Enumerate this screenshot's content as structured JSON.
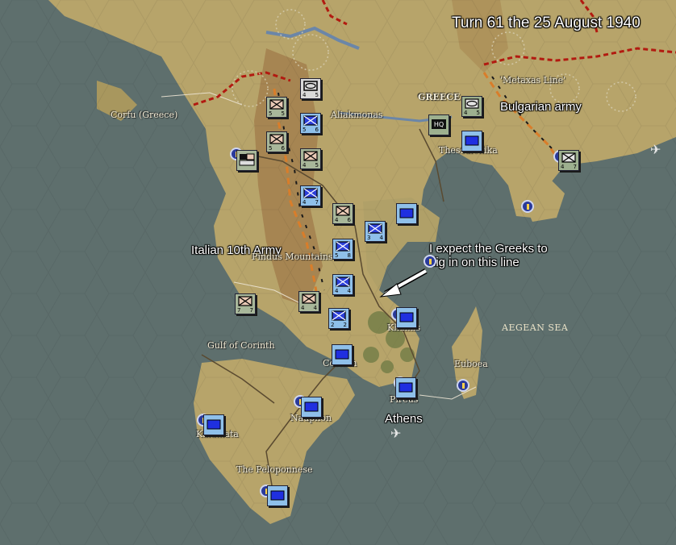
{
  "title": "Turn 61 the 25 August 1940",
  "annotations": {
    "bulgarian_army": "Bulgarian army",
    "italian_army": "Italian 10th Army",
    "expect": "I expect the Greeks to\ndig in on this line",
    "athens": "Athens"
  },
  "places": {
    "corfu": "Corfu (Greece)",
    "aliakmonas": "Aliakmonas",
    "greece": "GREECE",
    "thessaloniki": "Thessalonika",
    "metaxas": "'Metaxas Line'",
    "pindus": "Pindus Mountains",
    "gulf_corinth": "Gulf of Corinth",
    "corinth": "Corinth",
    "khalkis": "Khalkis",
    "aegean": "AEGEAN SEA",
    "euboea": "Euboea",
    "peloponnese": "The Peloponnese",
    "nauplion": "Nauplion",
    "kalamata": "Kalamata",
    "pireus": "Pireus"
  },
  "units": [
    {
      "id": "u1",
      "type": "axis-armor",
      "strength": "4",
      "moves": "5"
    },
    {
      "id": "u2",
      "type": "axis-infantry",
      "strength": "5",
      "moves": "5"
    },
    {
      "id": "u3",
      "type": "greek-infantry",
      "strength": "5",
      "moves": "6"
    },
    {
      "id": "u4",
      "type": "axis-infantry",
      "strength": "5",
      "moves": "6"
    },
    {
      "id": "u5",
      "type": "axis-mixed",
      "strength": "",
      "moves": ""
    },
    {
      "id": "u6",
      "type": "axis-infantry",
      "strength": "4",
      "moves": "5"
    },
    {
      "id": "u7",
      "type": "greek-infantry",
      "strength": "4",
      "moves": "7"
    },
    {
      "id": "u8",
      "type": "axis-infantry",
      "strength": "4",
      "moves": "6"
    },
    {
      "id": "u9",
      "type": "greek-infantry",
      "strength": "3",
      "moves": "4"
    },
    {
      "id": "u10",
      "type": "greek-infantry",
      "strength": "5",
      "moves": "8"
    },
    {
      "id": "u11",
      "type": "greek-infantry",
      "strength": "4",
      "moves": "4"
    },
    {
      "id": "u12",
      "type": "axis-infantry",
      "strength": "4",
      "moves": "4"
    },
    {
      "id": "u13",
      "type": "greek-infantry",
      "strength": "2",
      "moves": "2"
    },
    {
      "id": "u14",
      "type": "axis-infantry",
      "strength": "7",
      "moves": "7"
    },
    {
      "id": "u15",
      "type": "bulg-armor",
      "strength": "4",
      "moves": "5"
    },
    {
      "id": "u16",
      "type": "hq",
      "strength": "",
      "moves": ""
    },
    {
      "id": "u17",
      "type": "bulg-infantry",
      "strength": "4",
      "moves": "7"
    }
  ]
}
